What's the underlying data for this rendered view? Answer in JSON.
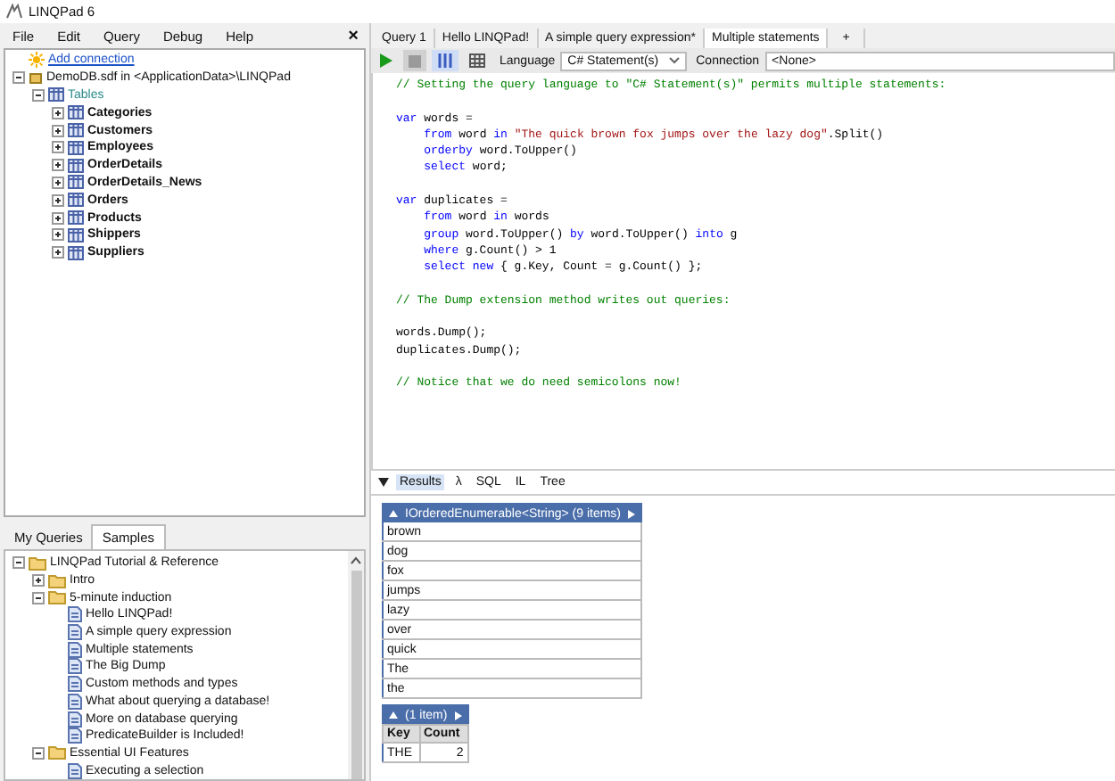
{
  "window": {
    "title": "LINQPad 6",
    "close": "×"
  },
  "menu": [
    "File",
    "Edit",
    "Query",
    "Debug",
    "Help"
  ],
  "connections": [
    {
      "kind": "add",
      "label": "Add connection"
    },
    {
      "kind": "database",
      "label": "DemoDB.sdf in <ApplicationData>\\LINQPad",
      "expanded": true,
      "children": [
        {
          "kind": "tables",
          "label": "Tables",
          "expanded": true,
          "children": [
            {
              "kind": "table",
              "label": "Categories",
              "expanded": false
            },
            {
              "kind": "table",
              "label": "Customers",
              "expanded": false
            },
            {
              "kind": "table",
              "label": "Employees",
              "expanded": false
            },
            {
              "kind": "table",
              "label": "OrderDetails",
              "expanded": false
            },
            {
              "kind": "table",
              "label": "OrderDetails_News",
              "expanded": false
            },
            {
              "kind": "table",
              "label": "Orders",
              "expanded": false
            },
            {
              "kind": "table",
              "label": "Products",
              "expanded": false
            },
            {
              "kind": "table",
              "label": "Shippers",
              "expanded": false
            },
            {
              "kind": "table",
              "label": "Suppliers",
              "expanded": false
            }
          ]
        }
      ]
    }
  ],
  "explorer_tabs": [
    {
      "label": "My Queries",
      "selected": false
    },
    {
      "label": "Samples",
      "selected": true
    }
  ],
  "samples": [
    {
      "kind": "folder",
      "label": "LINQPad Tutorial & Reference",
      "expanded": true,
      "children": [
        {
          "kind": "folder",
          "label": "Intro",
          "expanded": false
        },
        {
          "kind": "folder",
          "label": "5-minute induction",
          "expanded": true,
          "children": [
            {
              "kind": "file",
              "label": "Hello LINQPad!"
            },
            {
              "kind": "file",
              "label": "A simple query expression"
            },
            {
              "kind": "file",
              "label": "Multiple statements"
            },
            {
              "kind": "file",
              "label": "The Big Dump"
            },
            {
              "kind": "file",
              "label": "Custom methods and types"
            },
            {
              "kind": "file",
              "label": "What about querying a database!"
            },
            {
              "kind": "file",
              "label": "More on database querying"
            },
            {
              "kind": "file",
              "label": "PredicateBuilder is Included!"
            }
          ]
        },
        {
          "kind": "folder",
          "label": "Essential UI Features",
          "expanded": true,
          "children": [
            {
              "kind": "file",
              "label": "Executing a selection"
            }
          ]
        }
      ]
    }
  ],
  "query_tabs": [
    {
      "label": "Query 1",
      "selected": false
    },
    {
      "label": "Hello LINQPad!",
      "selected": false
    },
    {
      "label": "A simple query expression*",
      "selected": false
    },
    {
      "label": "Multiple statements",
      "selected": true
    }
  ],
  "new_tab": "+",
  "toolbar": {
    "stop_disabled": true,
    "view_modes": [
      {
        "kind": "rows",
        "selected": true
      },
      {
        "kind": "grid",
        "selected": false
      }
    ],
    "language_label": "Language",
    "language": "C# Statement(s)",
    "connection_label": "Connection",
    "connection": "<None>"
  },
  "code": [
    {
      "blank_before": false,
      "segments": [
        {
          "kind": "comment",
          "text": "// Setting the query language to \"C# Statement(s)\" permits multiple statements:"
        }
      ]
    },
    {
      "blank_before": true,
      "segments": [
        {
          "kind": "keyword",
          "text": "var"
        },
        {
          "kind": "plain",
          "text": " words ="
        }
      ]
    },
    {
      "blank_before": false,
      "segments": [
        {
          "kind": "keyword",
          "text": "    from"
        },
        {
          "kind": "plain",
          "text": " word "
        },
        {
          "kind": "keyword",
          "text": "in"
        },
        {
          "kind": "string",
          "text": " \"The quick brown fox jumps over the lazy dog\""
        },
        {
          "kind": "plain",
          "text": ".Split()"
        }
      ]
    },
    {
      "blank_before": false,
      "segments": [
        {
          "kind": "keyword",
          "text": "    orderby"
        },
        {
          "kind": "plain",
          "text": " word.ToUpper()"
        }
      ]
    },
    {
      "blank_before": false,
      "segments": [
        {
          "kind": "keyword",
          "text": "    select"
        },
        {
          "kind": "plain",
          "text": " word;"
        }
      ]
    },
    {
      "blank_before": true,
      "segments": [
        {
          "kind": "keyword",
          "text": "var"
        },
        {
          "kind": "plain",
          "text": " duplicates ="
        }
      ]
    },
    {
      "blank_before": false,
      "segments": [
        {
          "kind": "keyword",
          "text": "    from"
        },
        {
          "kind": "plain",
          "text": " word "
        },
        {
          "kind": "keyword",
          "text": "in"
        },
        {
          "kind": "plain",
          "text": " words"
        }
      ]
    },
    {
      "blank_before": false,
      "segments": [
        {
          "kind": "keyword",
          "text": "    group"
        },
        {
          "kind": "plain",
          "text": " word.ToUpper() "
        },
        {
          "kind": "keyword",
          "text": "by"
        },
        {
          "kind": "plain",
          "text": " word.ToUpper() "
        },
        {
          "kind": "keyword",
          "text": "into"
        },
        {
          "kind": "plain",
          "text": " g"
        }
      ]
    },
    {
      "blank_before": false,
      "segments": [
        {
          "kind": "keyword",
          "text": "    where"
        },
        {
          "kind": "plain",
          "text": " g.Count() > 1"
        }
      ]
    },
    {
      "blank_before": false,
      "segments": [
        {
          "kind": "keyword",
          "text": "    select new"
        },
        {
          "kind": "plain",
          "text": " { g.Key, Count = g.Count() };"
        }
      ]
    },
    {
      "blank_before": true,
      "segments": [
        {
          "kind": "comment",
          "text": "// The Dump extension method writes out queries:"
        }
      ]
    },
    {
      "blank_before": true,
      "segments": [
        {
          "kind": "plain",
          "text": "words.Dump();"
        }
      ]
    },
    {
      "blank_before": false,
      "segments": [
        {
          "kind": "plain",
          "text": "duplicates.Dump();"
        }
      ]
    },
    {
      "blank_before": true,
      "segments": [
        {
          "kind": "comment",
          "text": "// Notice that we do need semicolons now!"
        }
      ]
    }
  ],
  "result_tabs": [
    {
      "label": "Results",
      "selected": true
    },
    {
      "label": "λ",
      "selected": false
    },
    {
      "label": "SQL",
      "selected": false
    },
    {
      "label": "IL",
      "selected": false
    },
    {
      "label": "Tree",
      "selected": false
    }
  ],
  "results": [
    {
      "title": "IOrderedEnumerable<String> (9 items)",
      "rows": [
        [
          "brown"
        ],
        [
          "dog"
        ],
        [
          "fox"
        ],
        [
          "jumps"
        ],
        [
          "lazy"
        ],
        [
          "over"
        ],
        [
          "quick"
        ],
        [
          "The"
        ],
        [
          "the"
        ]
      ]
    },
    {
      "title": "(1 item)",
      "columns": [
        "Key",
        "Count"
      ],
      "rows": [
        [
          "THE",
          "2"
        ]
      ]
    }
  ]
}
